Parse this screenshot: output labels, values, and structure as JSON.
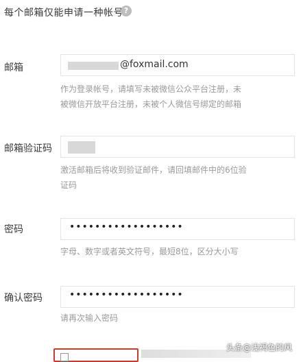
{
  "header": {
    "text": "每个邮箱仅能申请一种帐号",
    "help_glyph": "?"
  },
  "email": {
    "label": "邮箱",
    "value_suffix": "@foxmail.com",
    "hint_line1": "作为登录帐号，请填写未被微信公众平台注册，未",
    "hint_line2": "被微信开放平台注册，未被个人微信号绑定的邮箱"
  },
  "verify_code": {
    "label": "邮箱验证码",
    "hint_line1": "激活邮箱后将收到验证邮件，请回填邮件中的6位验",
    "hint_line2": "证码"
  },
  "password": {
    "label": "密码",
    "value": "••••••••••••••••••",
    "hint": "字母、数字或者英文符号，最短8位，区分大小写"
  },
  "confirm_password": {
    "label": "确认密码",
    "value": "••••••••••••••••••",
    "hint": "请再次输入密码"
  },
  "watermark": "头条@浅褐色的风"
}
